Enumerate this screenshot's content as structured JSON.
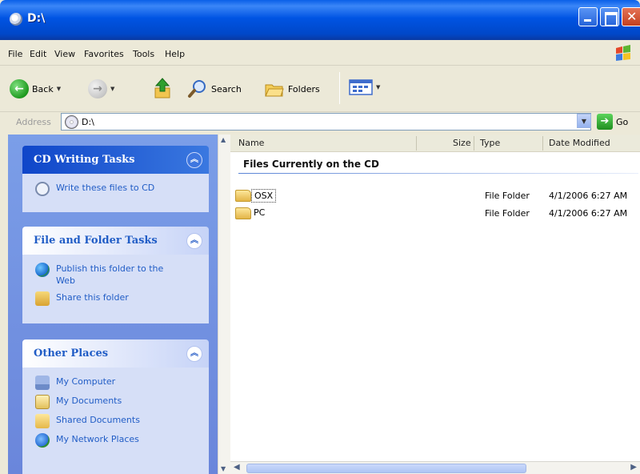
{
  "window": {
    "title": "D:\\"
  },
  "menu": [
    "File",
    "Edit",
    "View",
    "Favorites",
    "Tools",
    "Help"
  ],
  "toolbar": {
    "back": "Back",
    "search": "Search",
    "folders": "Folders"
  },
  "address": {
    "label": "Address",
    "value": "D:\\",
    "go": "Go"
  },
  "tasks": {
    "cd_writing": {
      "title": "CD Writing Tasks",
      "items": [
        "Write these files to CD"
      ]
    },
    "file_folder": {
      "title": "File and Folder Tasks",
      "items": [
        "Publish this folder to the Web",
        "Share this folder"
      ]
    },
    "other_places": {
      "title": "Other Places",
      "items": [
        "My Computer",
        "My Documents",
        "Shared Documents",
        "My Network Places"
      ]
    }
  },
  "columns": {
    "name": "Name",
    "size": "Size",
    "type": "Type",
    "date": "Date Modified"
  },
  "group": "Files Currently on the CD",
  "files": [
    {
      "name": "OSX",
      "type": "File Folder",
      "date": "4/1/2006 6:27 AM"
    },
    {
      "name": "PC",
      "type": "File Folder",
      "date": "4/1/2006 6:27 AM"
    }
  ],
  "icons": [
    "cd-drive-icon",
    "back-arrow-icon",
    "forward-arrow-icon",
    "up-folder-icon",
    "search-icon",
    "folders-icon",
    "views-icon",
    "go-arrow-icon",
    "folder-icon"
  ]
}
